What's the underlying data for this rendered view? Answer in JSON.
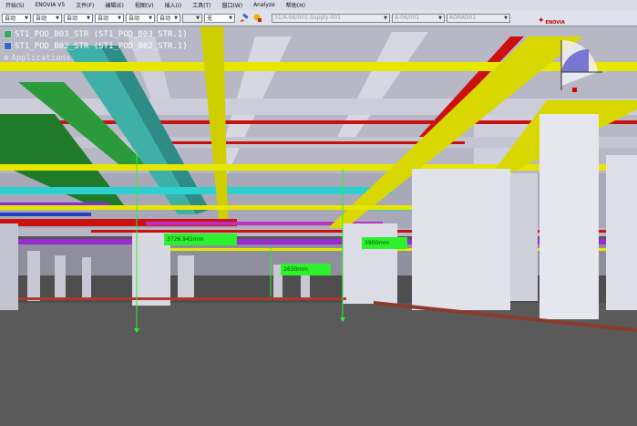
{
  "menubar": {
    "items": [
      "开始(S)",
      "ENOVIA V5",
      "文件(F)",
      "编辑(E)",
      "视图(V)",
      "插入(I)",
      "工具(T)",
      "窗口(W)",
      "Analyze",
      "帮助(H)"
    ]
  },
  "toolbar": {
    "selects": [
      "自动",
      "自动",
      "自动",
      "自动",
      "自动",
      "自动",
      "",
      "无"
    ],
    "filter_fields": [
      "31/A-06/001-Supply-001",
      "A-06/001",
      "ADRAD01"
    ]
  },
  "tree": {
    "nodes": [
      "ST1_POD_B03_STR (ST1_POD_B03_STR.1)",
      "ST1_POD_B02_STR (ST1_POD_B02_STR.1)"
    ],
    "root": "Applications"
  },
  "logo": {
    "text": "ENOVIA"
  },
  "measurements": [
    "3726.945mm",
    "3900mm",
    "2630mm"
  ],
  "colors": {
    "yellow_beam": "#e6e600",
    "teal_duct": "#3fb0a8",
    "red_pipe": "#cc1010",
    "green_duct": "#1f7a2a",
    "column": "#d6d6e0",
    "ceiling": "#b9b9c7",
    "floor": "#5a5a5a",
    "measure_label": "#2ef02e"
  }
}
